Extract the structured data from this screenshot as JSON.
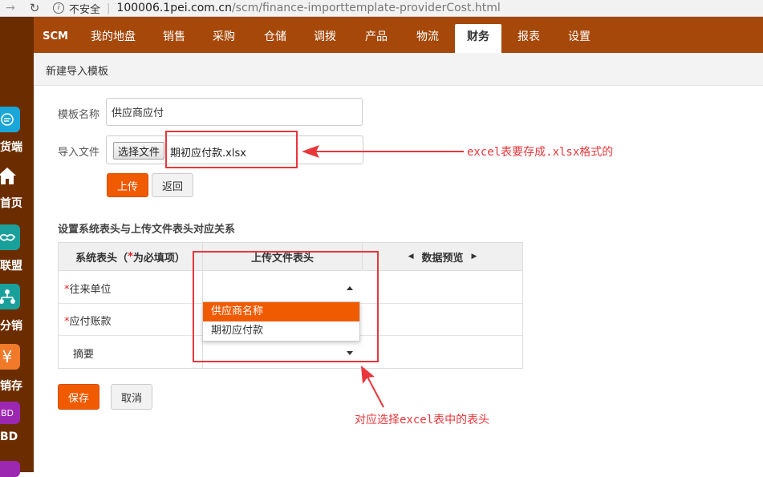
{
  "browser": {
    "security_label": "不安全",
    "url_host": "100006.1pei.com.cn",
    "url_path": "/scm/finance-importtemplate-providerCost.html"
  },
  "sidebar": {
    "items": [
      {
        "label": "货端",
        "icon": "chat-icon",
        "color": "#1aa6d8"
      },
      {
        "label": "首页",
        "icon": "home-icon",
        "color": "#6b2d00"
      },
      {
        "label": "联盟",
        "icon": "handshake-icon",
        "color": "#1aa09b"
      },
      {
        "label": "分销",
        "icon": "network-icon",
        "color": "#1aa09b"
      },
      {
        "label": "销存",
        "icon": "yen-icon",
        "color": "#f07a2a"
      },
      {
        "label": "BD",
        "icon": "bd-icon",
        "color": "#9c27b0"
      }
    ]
  },
  "menu": {
    "items": [
      "SCM",
      "我的地盘",
      "销售",
      "采购",
      "仓储",
      "调拨",
      "产品",
      "物流",
      "财务",
      "报表",
      "设置"
    ],
    "active": "财务"
  },
  "page": {
    "title": "新建导入模板"
  },
  "form": {
    "template_name_label": "模板名称",
    "template_name_value": "供应商应付",
    "import_file_label": "导入文件",
    "choose_file_label": "选择文件",
    "file_name": "期初应付款.xlsx",
    "upload_label": "上传",
    "back_label": "返回"
  },
  "mapping": {
    "section_title": "设置系统表头与上传文件表头对应关系",
    "col_system_prefix": "系统表头（",
    "col_system_star": "*",
    "col_system_suffix": "为必填项）",
    "col_upload": "上传文件表头",
    "col_preview": "数据预览",
    "rows": [
      {
        "required": true,
        "label": "往来单位"
      },
      {
        "required": true,
        "label": "应付账款"
      },
      {
        "required": false,
        "label": "摘要"
      }
    ],
    "star": "*",
    "dropdown_options": [
      "供应商名称",
      "期初应付款"
    ],
    "dropdown_selected": "供应商名称"
  },
  "actions": {
    "save_label": "保存",
    "cancel_label": "取消"
  },
  "annotations": {
    "file_note": "excel表要存成.xlsx格式的",
    "header_note": "对应选择excel表中的表头",
    "color": "#e8363a"
  }
}
